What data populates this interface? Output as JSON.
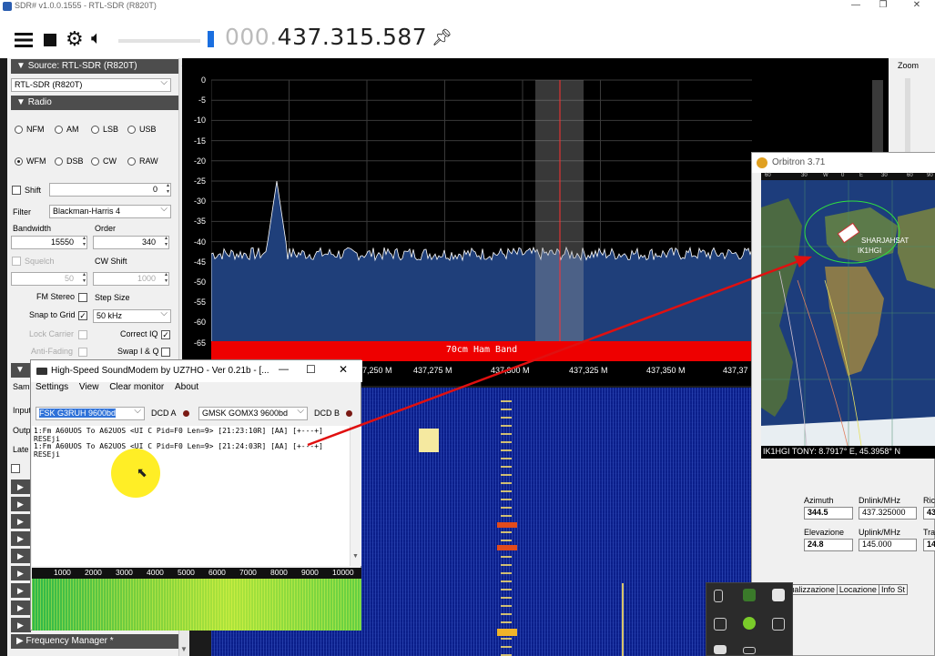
{
  "sdr": {
    "title": "SDR# v1.0.0.1555 - RTL-SDR (R820T)",
    "frequency_dim": "000.",
    "frequency": "437.315.587",
    "source_header": "Source: RTL-SDR (R820T)",
    "source_value": "RTL-SDR (R820T)",
    "radio_header": "Radio",
    "modes": [
      "NFM",
      "AM",
      "LSB",
      "USB",
      "WFM",
      "DSB",
      "CW",
      "RAW"
    ],
    "selected_mode": "WFM",
    "shift_label": "Shift",
    "shift_value": "0",
    "filter_label": "Filter",
    "filter_value": "Blackman-Harris 4",
    "bandwidth_label": "Bandwidth",
    "bandwidth_value": "15550",
    "order_label": "Order",
    "order_value": "340",
    "squelch_label": "Squelch",
    "squelch_value": "50",
    "cwshift_label": "CW Shift",
    "cwshift_value": "1000",
    "fm_stereo_label": "FM Stereo",
    "step_size_label": "Step Size",
    "snap_label": "Snap to Grid",
    "step_value": "50 kHz",
    "lock_carrier_label": "Lock Carrier",
    "correct_iq_label": "Correct IQ",
    "anti_fading_label": "Anti-Fading",
    "swap_iq_label": "Swap I & Q",
    "freq_manager": "Frequency Manager *",
    "zoom_label": "Zoom",
    "spectrum_yticks": [
      "0",
      "-5",
      "-10",
      "-15",
      "-20",
      "-25",
      "-30",
      "-35",
      "-40",
      "-45",
      "-50",
      "-55",
      "-60",
      "-65"
    ],
    "spectrum_xticks": [
      "7,250 M",
      "437,275 M",
      "437,300 M",
      "437,325 M",
      "437,350 M",
      "437,37"
    ],
    "band_label": "70cm Ham Band",
    "left_partial_labels": [
      "Sam",
      "Input",
      "Outp",
      "Late",
      "U"
    ]
  },
  "soundmodem": {
    "title": "High-Speed SoundModem by UZ7HO - Ver 0.21b - [...",
    "menu": [
      "Settings",
      "View",
      "Clear monitor",
      "About"
    ],
    "modem_a": "FSK G3RUH 9600bd",
    "dcd_a": "DCD A",
    "modem_b": "GMSK GOMX3 9600bd",
    "dcd_b": "DCD B",
    "log": [
      "1:Fm A60UOS To A62UOS <UI C Pid=F0 Len=9> [21:23:10R] [AA] [+---+]",
      "RESEji",
      "1:Fm A60UOS To A62UOS <UI C Pid=F0 Len=9> [21:24:03R] [AA] [+---+]",
      "RESEji"
    ],
    "scale": [
      "1000",
      "2000",
      "3000",
      "4000",
      "5000",
      "6000",
      "7000",
      "8000",
      "9000",
      "10000"
    ]
  },
  "orbitron": {
    "title": "Orbitron 3.71",
    "sat_label": "SHARJAHSAT",
    "station_label": "IK1HGI",
    "status": "IK1HGI TONY: 8.7917° E, 45.3958° N",
    "azimuth_label": "Azimuth",
    "azimuth_value": "344.5",
    "dnlink_label": "Dnlink/MHz",
    "dnlink_value": "437.325000",
    "elevation_label": "Elevazione",
    "elevation_value": "24.8",
    "uplink_label": "Uplink/MHz",
    "uplink_value": "145.000",
    "ric_label": "Ric",
    "ric_value": "43",
    "tra_label": "Tra",
    "tra_value": "14",
    "tabs": [
      "ale",
      "Visualizzazione",
      "Locazione",
      "Info St"
    ],
    "top_scale": [
      "60",
      "30",
      "W",
      "0",
      "E",
      "30",
      "60",
      "90"
    ]
  },
  "colors": {
    "band": "#e00000",
    "spectrum_fill": "#1f3f7a",
    "waterfall": "#0a1e8a",
    "vfo_line": "#ff3030"
  }
}
